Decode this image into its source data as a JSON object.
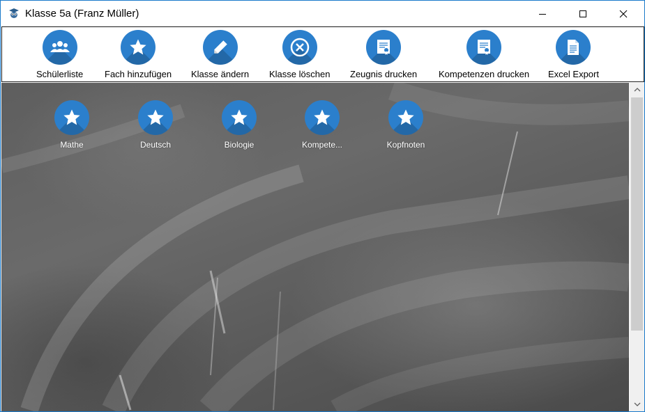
{
  "window": {
    "title": "Klasse 5a (Franz Müller)",
    "app_icon": "owl-graduation-icon"
  },
  "window_controls": {
    "minimize_icon": "minimize-icon",
    "maximize_icon": "maximize-icon",
    "close_icon": "close-icon"
  },
  "toolbar": {
    "items": [
      {
        "label": "Schülerliste",
        "icon": "users-icon"
      },
      {
        "label": "Fach hinzufügen",
        "icon": "star-icon"
      },
      {
        "label": "Klasse ändern",
        "icon": "pencil-icon"
      },
      {
        "label": "Klasse löschen",
        "icon": "delete-circle-icon"
      },
      {
        "label": "Zeugnis drucken",
        "icon": "certificate-icon"
      },
      {
        "label": "Kompetenzen drucken",
        "icon": "certificate-icon"
      },
      {
        "label": "Excel Export",
        "icon": "document-icon"
      }
    ]
  },
  "subjects": [
    {
      "label": "Mathe",
      "icon": "star-icon"
    },
    {
      "label": "Deutsch",
      "icon": "star-icon"
    },
    {
      "label": "Biologie",
      "icon": "star-icon"
    },
    {
      "label": "Kompete...",
      "icon": "star-icon"
    },
    {
      "label": "Kopfnoten",
      "icon": "star-icon"
    }
  ],
  "colors": {
    "accent": "#2b7fcc",
    "window_border": "#1979ca",
    "chalkboard": "#5e5e5e"
  }
}
